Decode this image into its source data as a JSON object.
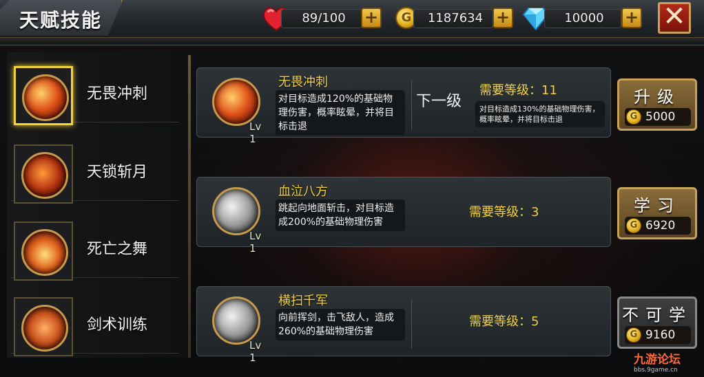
{
  "header": {
    "title": "天赋技能",
    "stamina": "89/100",
    "gold": "1187634",
    "diamonds": "10000",
    "plus_label": "+",
    "coin_letter": "G",
    "close_label": "✕"
  },
  "sidebar": {
    "items": [
      {
        "label": "无畏冲刺",
        "icon": "fire-dash-skill-icon",
        "active": true
      },
      {
        "label": "天锁斩月",
        "icon": "chain-moon-skill-icon",
        "active": false
      },
      {
        "label": "死亡之舞",
        "icon": "death-dance-skill-icon",
        "active": false
      },
      {
        "label": "剑术训练",
        "icon": "sword-training-skill-icon",
        "active": false
      }
    ]
  },
  "skills": [
    {
      "name": "无畏冲刺",
      "level": "Lv 1",
      "desc": "对目标造成120%的基础物理伤害，概率眩晕，并将目标击退",
      "next_label": "下一级",
      "requirement": "需要等级：11",
      "next_desc": "对目标造成130%的基础物理伤害，概率眩晕，并将目标击退",
      "action_label": "升级",
      "cost": "5000"
    },
    {
      "name": "血泣八方",
      "level": "Lv 1",
      "desc": "跳起向地面斩击，对目标造成200%的基础物理伤害",
      "requirement": "需要等级：3",
      "action_label": "学习",
      "cost": "6920"
    },
    {
      "name": "横扫千军",
      "level": "Lv 1",
      "desc": "向前挥剑，击飞敌人，造成260%的基础物理伤害",
      "requirement": "需要等级：5",
      "action_label": "不可学",
      "cost": "9160"
    }
  ],
  "watermark": {
    "brand": "九游论坛",
    "url": "bbs.9game.cn"
  },
  "colors": {
    "accent_gold": "#f2d23a",
    "close_red": "#b32a18",
    "panel_bg": "#2d3337"
  }
}
